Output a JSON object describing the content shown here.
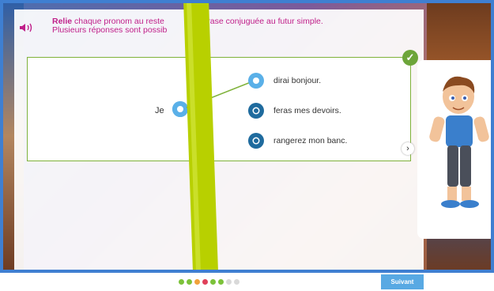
{
  "instruction": {
    "bold": "Relie",
    "rest_line1_a": " chaque pronom au reste",
    "rest_line1_b": "a phrase conjuguée au futur simple.",
    "line2": "Plusieurs réponses sont possib"
  },
  "pronoun": "Je",
  "choices": [
    {
      "label": "dirai bonjour."
    },
    {
      "label": "feras mes devoirs."
    },
    {
      "label": "rangerez mon banc."
    }
  ],
  "next_arrow": "›",
  "check_mark": "✓",
  "footer": {
    "next_button": "Suivant"
  },
  "progress_dots": [
    "#7cc23a",
    "#7cc23a",
    "#f1a23a",
    "#e0405a",
    "#7cc23a",
    "#7cc23a",
    "#d9d9d9",
    "#d9d9d9"
  ],
  "colors": {
    "accent": "#c0208a",
    "correct": "#6da53a",
    "link": "#7fb23a",
    "button": "#58a9e3"
  }
}
